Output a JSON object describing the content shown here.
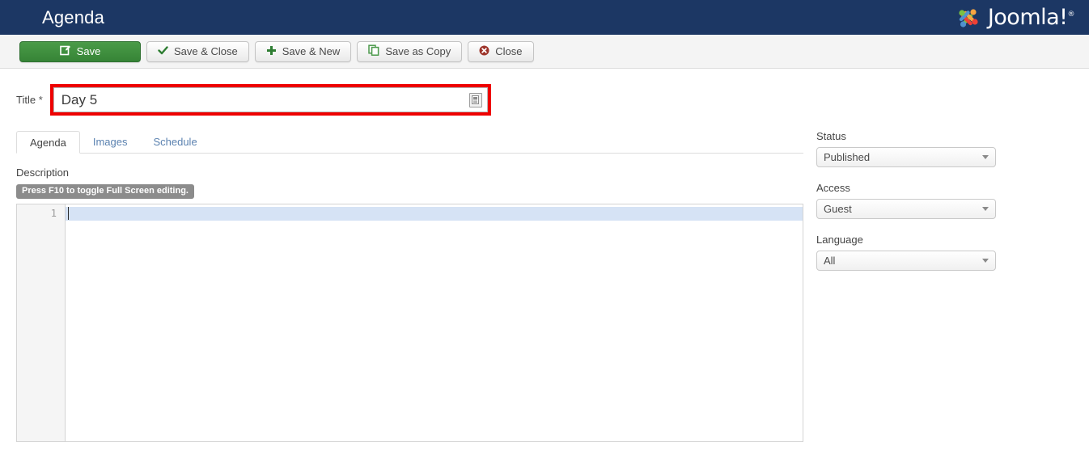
{
  "header": {
    "title": "Agenda",
    "brand_name": "Joomla!",
    "brand_registered": "®",
    "brand_colors": {
      "bar": "#1c3764",
      "logo_green": "#7ac143",
      "logo_orange": "#f9a541",
      "logo_red": "#ee4035",
      "logo_blue": "#5091cd"
    }
  },
  "toolbar": {
    "save_label": "Save",
    "save_close_label": "Save & Close",
    "save_new_label": "Save & New",
    "save_copy_label": "Save as Copy",
    "close_label": "Close",
    "save_button_color": "#3d8b3d"
  },
  "title_field": {
    "label": "Title",
    "required_marker": "*",
    "value": "Day 5",
    "placeholder": "",
    "highlight_color": "#ee0000"
  },
  "tabs": [
    {
      "label": "Agenda",
      "active": true
    },
    {
      "label": "Images",
      "active": false
    },
    {
      "label": "Schedule",
      "active": false
    }
  ],
  "description": {
    "label": "Description",
    "fullscreen_hint": "Press F10 to toggle Full Screen editing.",
    "editor_line_number": "1",
    "editor_content": ""
  },
  "sidebar": {
    "fields": [
      {
        "label": "Status",
        "value": "Published"
      },
      {
        "label": "Access",
        "value": "Guest"
      },
      {
        "label": "Language",
        "value": "All"
      }
    ]
  }
}
